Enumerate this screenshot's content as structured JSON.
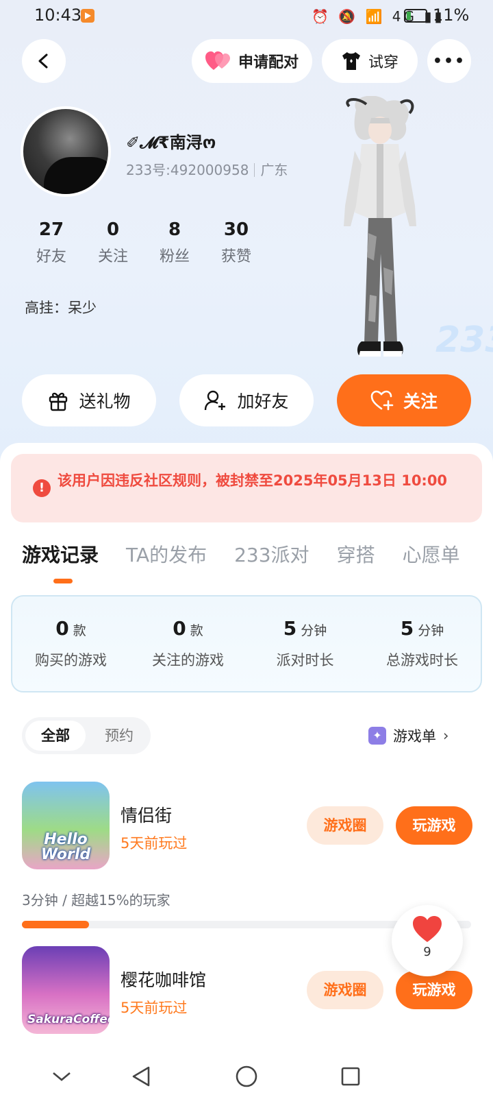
{
  "status_bar": {
    "time": "10:43",
    "icons": "⏰ 🔕 📶 4G ▮▮",
    "battery": "11%"
  },
  "top_actions": {
    "pair_label": "申请配对",
    "tryon_label": "试穿",
    "more_label": "•••"
  },
  "profile": {
    "username": "✐𝓜₹南浔ო",
    "uid": "233号:492000958",
    "region": "广东",
    "stats": [
      {
        "num": "27",
        "label": "好友"
      },
      {
        "num": "0",
        "label": "关注"
      },
      {
        "num": "8",
        "label": "粉丝"
      },
      {
        "num": "30",
        "label": "获赞"
      }
    ],
    "status_line": "高挂：呆少",
    "badge": "233"
  },
  "actions": {
    "gift": "送礼物",
    "add_friend": "加好友",
    "follow": "关注"
  },
  "ban_notice": {
    "icon": "!",
    "text": "该用户因违反社区规则，被封禁至2025年05月13日 10:00"
  },
  "tabs": [
    "游戏记录",
    "TA的发布",
    "233派对",
    "穿搭",
    "心愿单"
  ],
  "summary": [
    {
      "value": "0",
      "unit": "款",
      "label": "购买的游戏"
    },
    {
      "value": "0",
      "unit": "款",
      "label": "关注的游戏"
    },
    {
      "value": "5",
      "unit": "分钟",
      "label": "派对时长"
    },
    {
      "value": "5",
      "unit": "分钟",
      "label": "总游戏时长"
    }
  ],
  "filter": {
    "all": "全部",
    "reserve": "预约",
    "game_list": "游戏单",
    "game_list_icon": "✦",
    "chevron": "›"
  },
  "games": [
    {
      "title": "情侣街",
      "subtitle": "5天前玩过",
      "logo": "Hello World",
      "circle_label": "游戏圈",
      "play_label": "玩游戏"
    },
    {
      "title": "樱花咖啡馆",
      "subtitle": "5天前玩过",
      "logo": "SakuraCoffee",
      "circle_label": "游戏圈",
      "play_label": "玩游戏"
    }
  ],
  "playtime": "3分钟 / 超越15%的玩家",
  "progress_fraction": 0.15,
  "floating_like": {
    "count": "9"
  },
  "colors": {
    "accent": "#ff6f1a",
    "ban_red": "#ef4b3f",
    "ban_bg": "#fde6e4"
  }
}
